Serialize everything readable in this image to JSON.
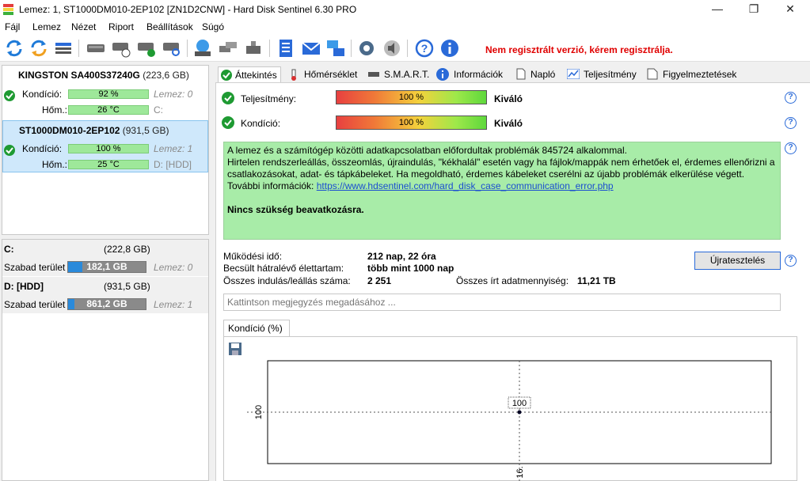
{
  "window": {
    "title": "Lemez: 1, ST1000DM010-2EP102 [ZN1D2CNW]  -  Hard Disk Sentinel 6.30 PRO",
    "minimize": "—",
    "maximize": "❐",
    "close": "✕"
  },
  "menu": [
    {
      "label": "Fájl"
    },
    {
      "label": "Lemez"
    },
    {
      "label": "Nézet"
    },
    {
      "label": "Riport"
    },
    {
      "label": "Beállítások"
    },
    {
      "label": "Súgó"
    }
  ],
  "toolbar": {
    "registration_notice": "Nem regisztrált verzió, kérem regisztrálja."
  },
  "disks": [
    {
      "name": "KINGSTON SA400S37240G",
      "size": "(223,6 GB)",
      "condition_label": "Kondíció:",
      "condition_value": "92 %",
      "condition_level": 0.92,
      "disk_ref": "Lemez: 0",
      "temp_label": "Hőm.:",
      "temp_value": "26 °C",
      "drive_letter": "C:"
    },
    {
      "name": "ST1000DM010-2EP102",
      "size": "(931,5 GB)",
      "condition_label": "Kondíció:",
      "condition_value": "100 %",
      "condition_level": 1.0,
      "disk_ref": "Lemez: 1",
      "temp_label": "Hőm.:",
      "temp_value": "25 °C",
      "drive_letter": "D: [HDD]"
    }
  ],
  "volumes": [
    {
      "name": "C:",
      "size": "(222,8 GB)",
      "free_label": "Szabad terület",
      "free_value": "182,1 GB",
      "free_fraction": 0.82,
      "disk_ref": "Lemez: 0"
    },
    {
      "name": "D: [HDD]",
      "size": "(931,5 GB)",
      "free_label": "Szabad terület",
      "free_value": "861,2 GB",
      "free_fraction": 0.92,
      "disk_ref": "Lemez: 1"
    }
  ],
  "tabs": [
    {
      "label": "Áttekintés"
    },
    {
      "label": "Hőmérséklet"
    },
    {
      "label": "S.M.A.R.T."
    },
    {
      "label": "Információk"
    },
    {
      "label": "Napló"
    },
    {
      "label": "Teljesítmény"
    },
    {
      "label": "Figyelmeztetések"
    }
  ],
  "overview": {
    "performance_label": "Teljesítmény:",
    "performance_value": "100 %",
    "performance_rating": "Kiváló",
    "condition_label": "Kondíció:",
    "condition_value": "100 %",
    "condition_rating": "Kiváló",
    "message_line1": "A lemez és a számítógép közötti adatkapcsolatban előfordultak problémák 845724 alkalommal.",
    "message_line2": "Hirtelen rendszerleállás, összeomlás, újraindulás, \"kékhalál\" esetén vagy ha fájlok/mappák nem érhetőek el, érdemes ellenőrizni a csatlakozásokat, adat- és tápkábeleket. Ha megoldható, érdemes kábeleket cserélni az újabb problémák elkerülése végett.",
    "more_info_label": "További információk:",
    "more_info_link": "https://www.hdsentinel.com/hard_disk_case_communication_error.php",
    "no_action": "Nincs szükség beavatkozásra.",
    "uptime_label": "Működési idő:",
    "uptime_value": "212 nap, 22 óra",
    "remaining_label": "Becsült hátralévő élettartam:",
    "remaining_value": "több mint 1000 nap",
    "startstop_label": "Összes indulás/leállás száma:",
    "startstop_value": "2 251",
    "written_label": "Összes írt adatmennyiség:",
    "written_value": "11,21 TB",
    "retest_button": "Újratesztelés",
    "note_placeholder": "Kattintson megjegyzés megadásához ...",
    "chart_tab": "Kondíció  (%)"
  },
  "help_glyph": "?",
  "chart_data": {
    "type": "line",
    "x": [
      "16."
    ],
    "series": [
      {
        "values": [
          100
        ]
      }
    ],
    "point_label": "100",
    "ytick": "100",
    "xtick": "16.",
    "grid": "dotted-crosshair"
  }
}
